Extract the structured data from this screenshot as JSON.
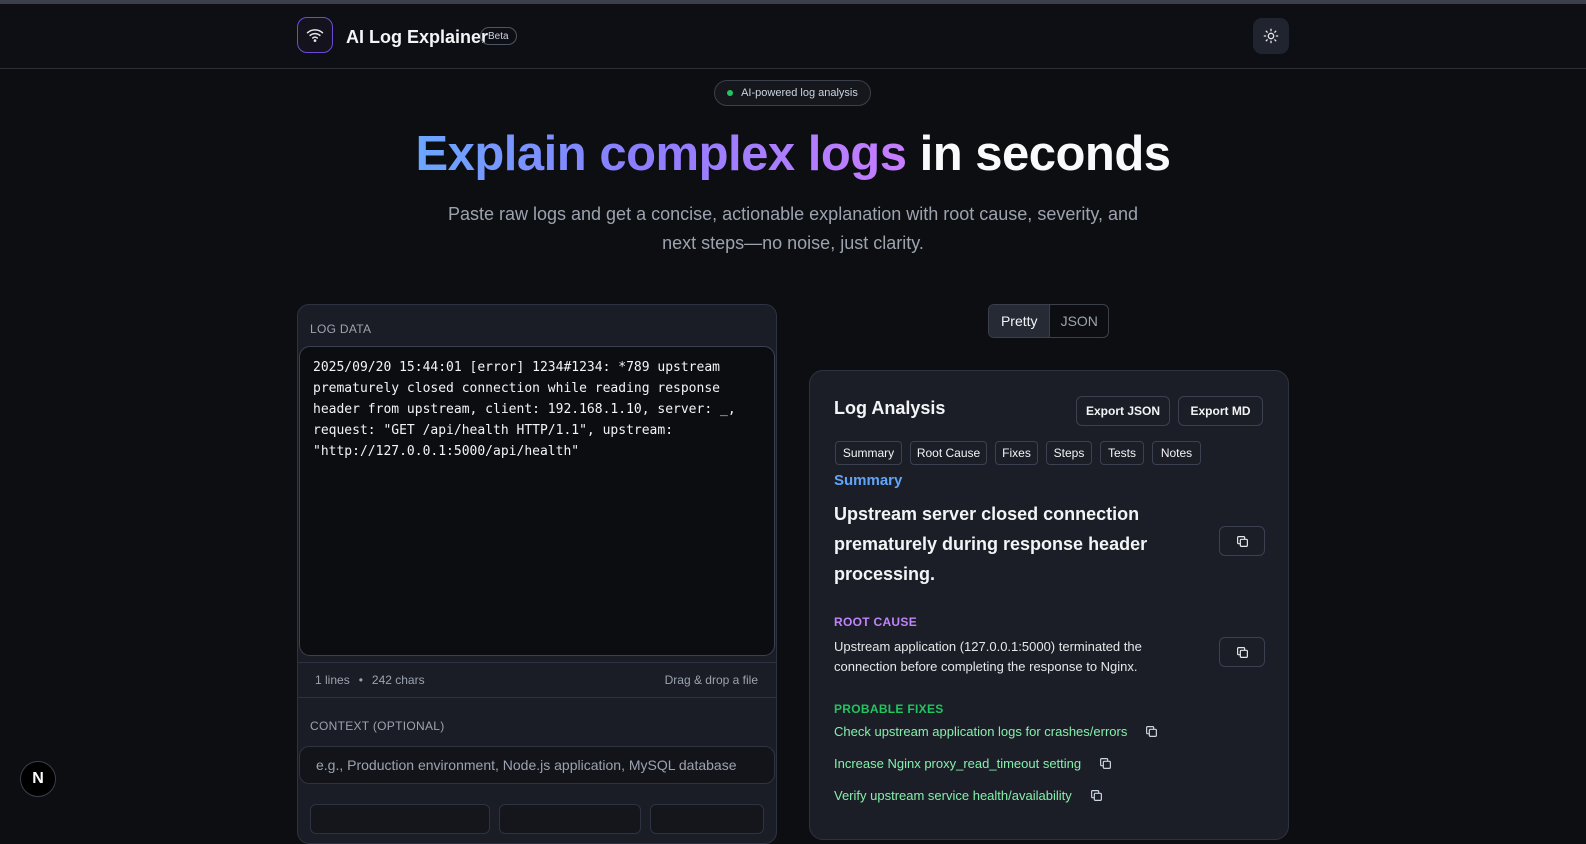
{
  "header": {
    "brand": "AI Log Explainer",
    "beta": "Beta",
    "logo_icon": "wifi-icon",
    "theme_icon": "sun-icon"
  },
  "hero": {
    "pill": "AI-powered log analysis",
    "title_gradient": "Explain complex logs",
    "title_plain": " in seconds",
    "subtitle": "Paste raw logs and get a concise, actionable explanation with root cause, severity, and next steps—no noise, just clarity."
  },
  "left": {
    "log_label": "LOG DATA",
    "log_value": "2025/09/20 15:44:01 [error] 1234#1234: *789 upstream\nprematurely closed connection while reading response\nheader from upstream, client: 192.168.1.10, server: _,\nrequest: \"GET /api/health HTTP/1.1\", upstream:\n\"http://127.0.0.1:5000/api/health\"",
    "lines": "1 lines",
    "bullet": "•",
    "chars": "242 chars",
    "drag_drop": "Drag & drop a file",
    "context_label": "CONTEXT (OPTIONAL)",
    "context_placeholder": "e.g., Production environment, Node.js application, MySQL database"
  },
  "toggle": {
    "pretty": "Pretty",
    "json": "JSON",
    "selected": "Pretty"
  },
  "analysis": {
    "title": "Log Analysis",
    "export_json": "Export JSON",
    "export_md": "Export MD",
    "chips": [
      "Summary",
      "Root Cause",
      "Fixes",
      "Steps",
      "Tests",
      "Notes"
    ],
    "summary_heading": "Summary",
    "summary_text": "Upstream server closed connection prematurely during response header processing.",
    "root_heading": "ROOT CAUSE",
    "root_text": "Upstream application (127.0.0.1:5000) terminated the connection before completing the response to Nginx.",
    "fixes_heading": "PROBABLE FIXES",
    "fixes": [
      "Check upstream application logs for crashes/errors",
      "Increase Nginx proxy_read_timeout setting",
      "Verify upstream service health/availability"
    ]
  },
  "badge": "N",
  "colors": {
    "accent_blue": "#60a5fa",
    "accent_purple": "#c084fc",
    "accent_green": "#22c55e"
  }
}
